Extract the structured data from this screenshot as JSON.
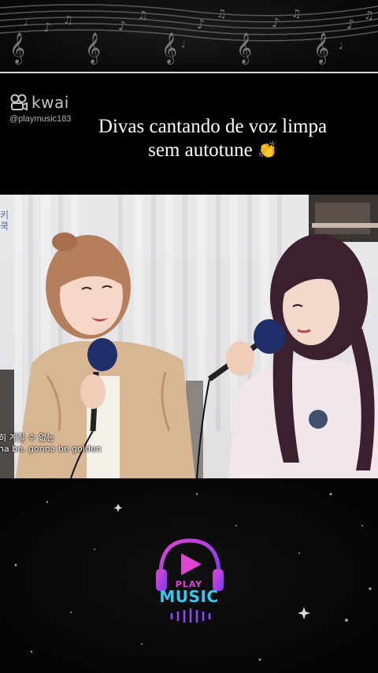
{
  "watermark": {
    "brand": "kwai",
    "handle": "@playmusic183",
    "icon": "kwai-logo-icon"
  },
  "caption": {
    "line1": "Divas cantando de voz limpa",
    "line2": "sem autotune",
    "emoji": "👏"
  },
  "video": {
    "subtitle_korean": "히 계질 수 없는",
    "subtitle_english": "na be, gonna be golden"
  },
  "logo": {
    "play": "PLAY",
    "music": "MUSIC",
    "icon": "headphones-play-icon"
  },
  "colors": {
    "logo_magenta": "#e045d0",
    "logo_cyan": "#35c8f2",
    "banner_bg": "#0a0a0a"
  }
}
